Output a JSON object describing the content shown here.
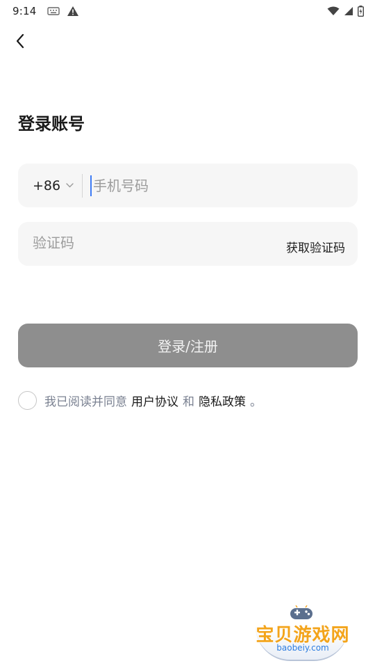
{
  "status_bar": {
    "time": "9:14",
    "left_icons": [
      "keyboard-icon",
      "warning-icon"
    ],
    "right_icons": [
      "wifi-icon",
      "signal-icon",
      "battery-icon"
    ]
  },
  "nav": {
    "back_icon": "back-chevron-icon"
  },
  "title": "登录账号",
  "phone": {
    "country_code": "+86",
    "dropdown_icon": "chevron-down-icon",
    "placeholder": "手机号码",
    "value": ""
  },
  "code": {
    "placeholder": "验证码",
    "value": "",
    "get_code_label": "获取验证码"
  },
  "submit": {
    "label": "登录/注册"
  },
  "agreement": {
    "checked": false,
    "prefix": "我已阅读并同意",
    "terms_label": "用户协议",
    "joiner": "和",
    "privacy_label": "隐私政策",
    "suffix": "。"
  },
  "watermark": {
    "logo": "宝贝游戏网",
    "url": "baobeiy.com",
    "icon": "gamepad-icon"
  },
  "colors": {
    "button_disabled": "#8e8e8e",
    "field_bg": "#f6f6f6",
    "cursor": "#3d7bf5",
    "muted_text": "#7a8191"
  }
}
